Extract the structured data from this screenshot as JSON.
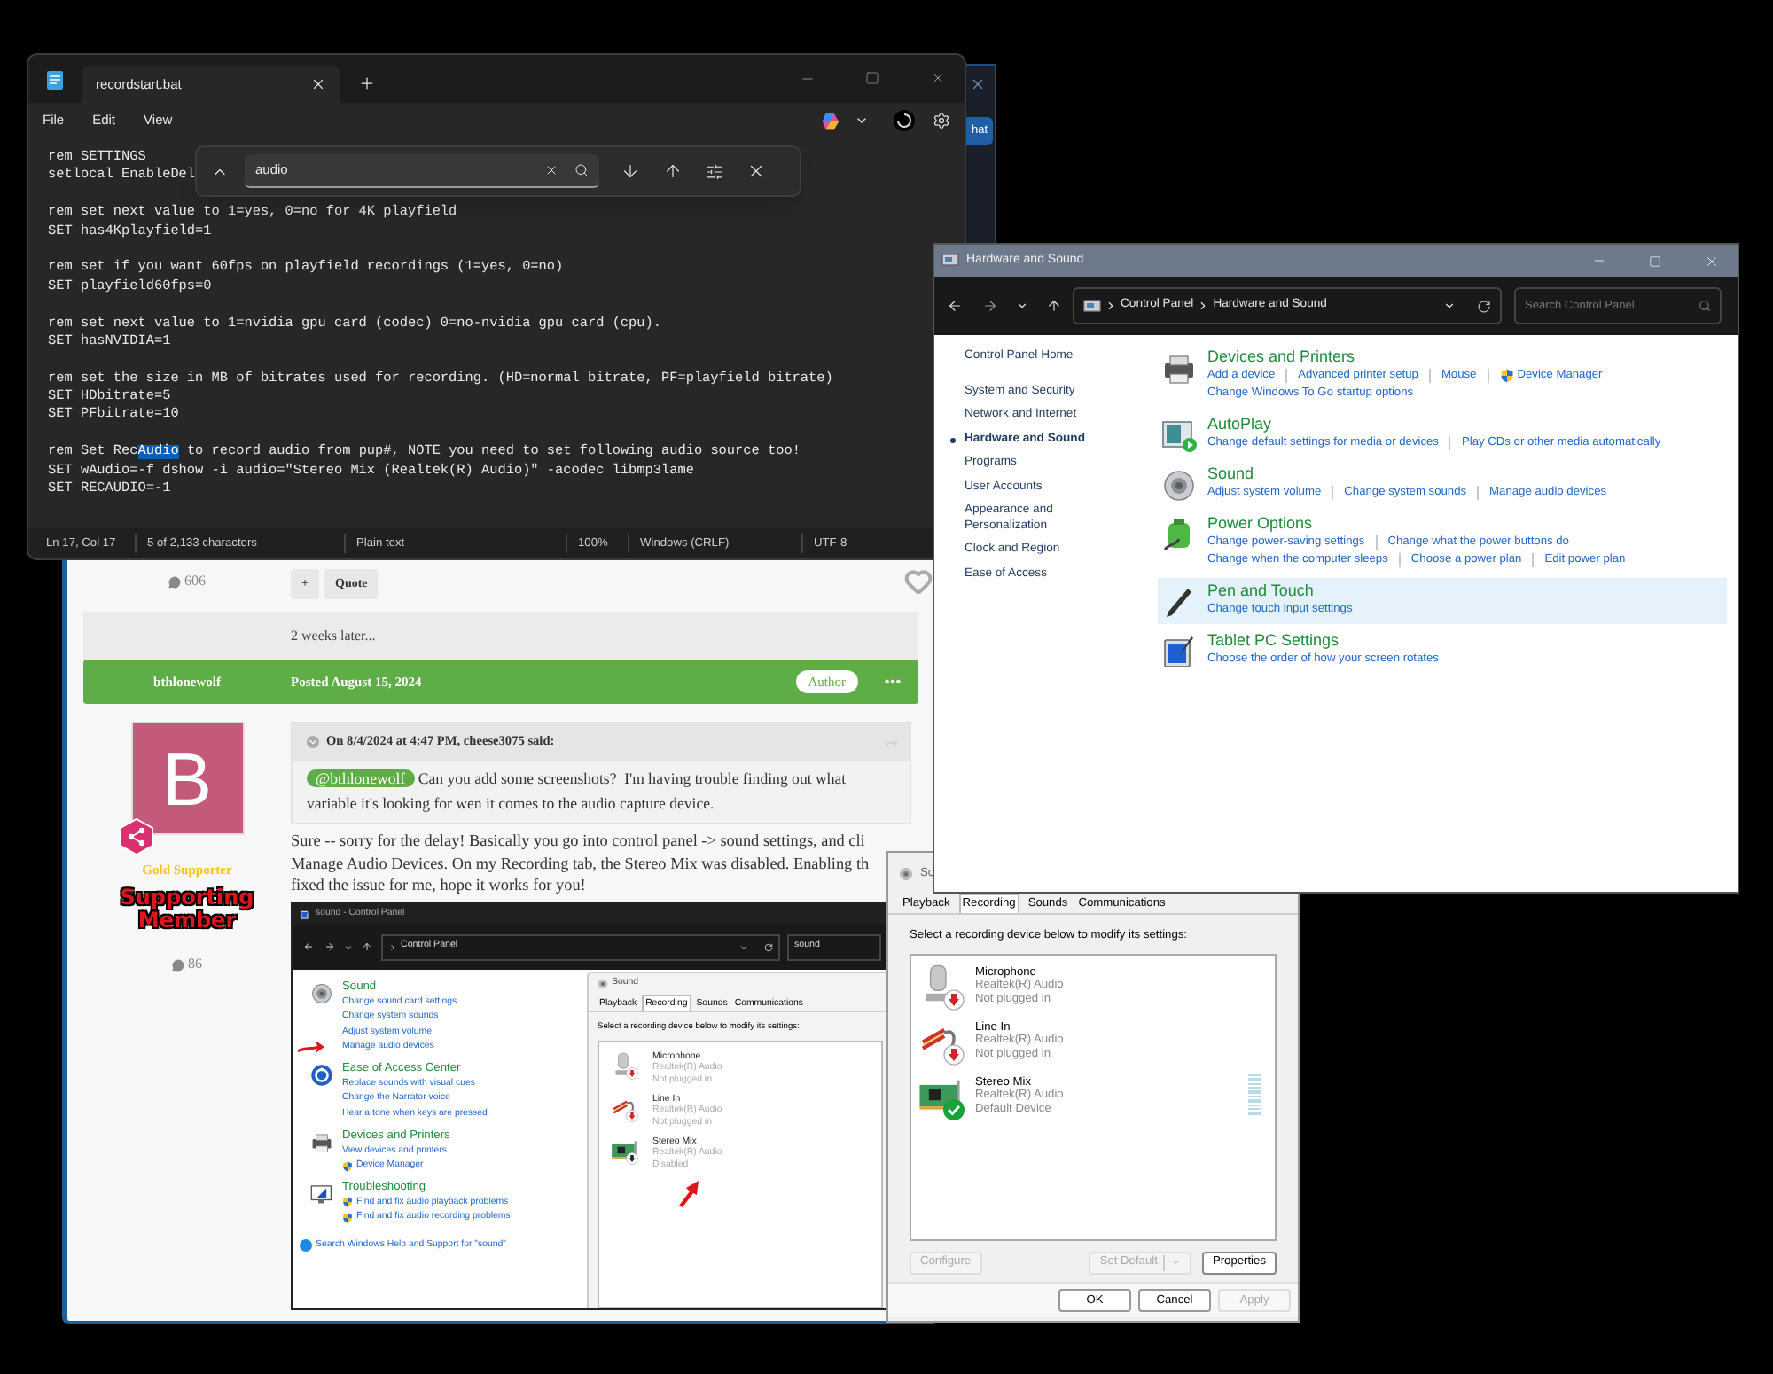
{
  "background_window": {
    "button": "hat"
  },
  "notepad": {
    "tab_title": "recordstart.bat",
    "menu": [
      "File",
      "Edit",
      "View"
    ],
    "find": {
      "value": "audio"
    },
    "blocks": [
      [
        [
          {
            "text": "rem SETTINGS",
            "highlighted": false
          }
        ],
        [
          {
            "text": "setlocal EnableDel",
            "highlighted": false
          }
        ]
      ],
      [
        [
          {
            "text": "rem set next value to 1=yes, 0=no for 4K playfield",
            "highlighted": false
          }
        ],
        [
          {
            "text": "SET has4Kplayfield=1",
            "highlighted": false
          }
        ]
      ],
      [
        [
          {
            "text": "rem set if you want 60fps on playfield recordings (1=yes, 0=no)",
            "highlighted": false
          }
        ],
        [
          {
            "text": "SET playfield60fps=0",
            "highlighted": false
          }
        ]
      ],
      [
        [
          {
            "text": "rem set next value to 1=nvidia gpu card (codec) 0=no-nvidia gpu card (cpu).",
            "highlighted": false
          }
        ],
        [
          {
            "text": "SET hasNVIDIA=1",
            "highlighted": false
          }
        ]
      ],
      [
        [
          {
            "text": "rem set the size in MB of bitrates used for recording. (HD=normal bitrate, PF=playfield bitrate)",
            "highlighted": false
          }
        ],
        [
          {
            "text": "SET HDbitrate=5",
            "highlighted": false
          }
        ],
        [
          {
            "text": "SET PFbitrate=10",
            "highlighted": false
          }
        ]
      ],
      [
        [
          {
            "text": "rem Set Rec",
            "highlighted": false
          },
          {
            "text": "Audio",
            "highlighted": true
          },
          {
            "text": " to record audio from pup#, NOTE you need to set following audio source too!",
            "highlighted": false
          }
        ],
        [
          {
            "text": "SET wAudio=-f dshow -i audio=\"Stereo Mix (Realtek(R) Audio)\" -acodec libmp3lame",
            "highlighted": false
          }
        ],
        [
          {
            "text": "SET RECAUDIO=-1",
            "highlighted": false
          }
        ]
      ]
    ],
    "status_bar": [
      "Ln 17, Col 17",
      "5 of 2,133 characters",
      "Plain text",
      "100%",
      "Windows (CRLF)",
      "UTF-8"
    ]
  },
  "control_panel": {
    "title": "Hardware and Sound",
    "breadcrumb": [
      "Control Panel",
      "Hardware and Sound"
    ],
    "search": {
      "placeholder": "Search Control Panel"
    },
    "sidebar": [
      {
        "label": "Control Panel Home",
        "selected": false
      },
      {
        "label": "System and Security",
        "selected": false
      },
      {
        "label": "Network and Internet",
        "selected": false
      },
      {
        "label": "Hardware and Sound",
        "selected": true
      },
      {
        "label": "Programs",
        "selected": false
      },
      {
        "label": "User Accounts",
        "selected": false
      },
      {
        "label": "Appearance and Personalization",
        "selected": false
      },
      {
        "label": "Clock and Region",
        "selected": false
      },
      {
        "label": "Ease of Access",
        "selected": false
      }
    ],
    "categories": [
      {
        "title": "Devices and Printers",
        "selected": false,
        "link_rows": [
          [
            {
              "text": "Add a device",
              "kind": "plain"
            },
            {
              "text": "Advanced printer setup",
              "kind": "plain"
            },
            {
              "text": "Mouse",
              "kind": "plain"
            },
            {
              "text": "Device Manager",
              "kind": "shield"
            }
          ],
          [
            {
              "text": "Change Windows To Go startup options",
              "kind": "plain"
            }
          ]
        ]
      },
      {
        "title": "AutoPlay",
        "selected": false,
        "link_rows": [
          [
            {
              "text": "Change default settings for media or devices",
              "kind": "plain"
            },
            {
              "text": "Play CDs or other media automatically",
              "kind": "plain"
            }
          ]
        ]
      },
      {
        "title": "Sound",
        "selected": false,
        "link_rows": [
          [
            {
              "text": "Adjust system volume",
              "kind": "plain"
            },
            {
              "text": "Change system sounds",
              "kind": "plain"
            },
            {
              "text": "Manage audio devices",
              "kind": "plain"
            }
          ]
        ]
      },
      {
        "title": "Power Options",
        "selected": false,
        "link_rows": [
          [
            {
              "text": "Change power-saving settings",
              "kind": "plain"
            },
            {
              "text": "Change what the power buttons do",
              "kind": "plain"
            }
          ],
          [
            {
              "text": "Change when the computer sleeps",
              "kind": "plain"
            },
            {
              "text": "Choose a power plan",
              "kind": "plain"
            },
            {
              "text": "Edit power plan",
              "kind": "plain"
            }
          ]
        ]
      },
      {
        "title": "Pen and Touch",
        "selected": true,
        "link_rows": [
          [
            {
              "text": "Change touch input settings",
              "kind": "plain"
            }
          ]
        ]
      },
      {
        "title": "Tablet PC Settings",
        "selected": false,
        "link_rows": [
          [
            {
              "text": "Choose the order of how your screen rotates",
              "kind": "plain"
            }
          ]
        ]
      }
    ]
  },
  "sound_dialog": {
    "title": "So",
    "tabs": [
      {
        "label": "Playback",
        "selected": false
      },
      {
        "label": "Recording",
        "selected": true
      },
      {
        "label": "Sounds",
        "selected": false
      },
      {
        "label": "Communications",
        "selected": false
      }
    ],
    "instruction": "Select a recording device below to modify its settings:",
    "devices": [
      {
        "name": "Microphone",
        "driver": "Realtek(R) Audio",
        "status": "Not plugged in",
        "unplugged": true,
        "is_default": false
      },
      {
        "name": "Line In",
        "driver": "Realtek(R) Audio",
        "status": "Not plugged in",
        "unplugged": true,
        "is_default": false
      },
      {
        "name": "Stereo Mix",
        "driver": "Realtek(R) Audio",
        "status": "Default Device",
        "unplugged": false,
        "is_default": true
      }
    ],
    "buttons": [
      {
        "label": "Configure",
        "kind": "plain",
        "disabled": true
      },
      {
        "label": "Set Default",
        "kind": "split",
        "disabled": true
      },
      {
        "label": "Properties",
        "kind": "plain",
        "disabled": false
      }
    ],
    "footer_buttons": [
      {
        "label": "OK",
        "disabled": false
      },
      {
        "label": "Cancel",
        "disabled": false
      },
      {
        "label": "Apply",
        "disabled": true
      }
    ]
  },
  "forum": {
    "previous_post": {
      "comment_count": "606",
      "buttons": [
        "+",
        "Quote"
      ]
    },
    "time_gap": "2 weeks later...",
    "post": {
      "author": "bthlonewolf",
      "date": "Posted August 15, 2024",
      "badge": "Author",
      "avatar_letter": "B",
      "member_group": "Gold Supporter",
      "rank_title": "Supporting Member",
      "comment_count": "86",
      "quote": {
        "header": "On 8/4/2024 at 4:47 PM, cheese3075 said:",
        "mention": "@bthlonewolf",
        "text": "Can you add some screenshots?  I'm having trouble finding out what variable it's looking for wen it comes to the audio capture device."
      },
      "body_lines": [
        "Sure -- sorry for the delay! Basically you go into control panel -> sound settings, and cli",
        "Manage Audio Devices. On my Recording tab, the Stereo Mix was disabled. Enabling th",
        "fixed the issue for me, hope it works for you!"
      ],
      "screenshot": {
        "title": "sound - Control Panel",
        "address": "Control Panel",
        "search": "sound",
        "sections": [
          {
            "title": "Sound",
            "links": [
              {
                "text": "Change sound card settings",
                "kind": "plain",
                "pointed": false
              },
              {
                "text": "Change system sounds",
                "kind": "plain",
                "pointed": false
              },
              {
                "text": "Adjust system volume",
                "kind": "plain",
                "pointed": false
              },
              {
                "text": "Manage audio devices",
                "kind": "plain",
                "pointed": true
              }
            ]
          },
          {
            "title": "Ease of Access Center",
            "links": [
              {
                "text": "Replace sounds with visual cues",
                "kind": "plain",
                "pointed": false
              },
              {
                "text": "Change the Narrator voice",
                "kind": "plain",
                "pointed": false
              },
              {
                "text": "Hear a tone when keys are pressed",
                "kind": "plain",
                "pointed": false
              }
            ]
          },
          {
            "title": "Devices and Printers",
            "links": [
              {
                "text": "View devices and printers",
                "kind": "plain",
                "pointed": false
              },
              {
                "text": "Device Manager",
                "kind": "shield",
                "pointed": false
              }
            ]
          },
          {
            "title": "Troubleshooting",
            "links": [
              {
                "text": "Find and fix audio playback problems",
                "kind": "shield",
                "pointed": false
              },
              {
                "text": "Find and fix audio recording problems",
                "kind": "shield",
                "pointed": false
              }
            ]
          }
        ],
        "help_link": "Search Windows Help and Support for \"sound\"",
        "dialog": {
          "title": "Sound",
          "tabs": [
            {
              "label": "Playback",
              "selected": false
            },
            {
              "label": "Recording",
              "selected": true
            },
            {
              "label": "Sounds",
              "selected": false
            },
            {
              "label": "Communications",
              "selected": false
            }
          ],
          "instruction": "Select a recording device below to modify its settings:",
          "devices": [
            {
              "name": "Microphone",
              "driver": "Realtek(R) Audio",
              "status": "Not plugged in",
              "unplugged": true,
              "disabled": false,
              "pointed": false
            },
            {
              "name": "Line In",
              "driver": "Realtek(R) Audio",
              "status": "Not plugged in",
              "unplugged": true,
              "disabled": false,
              "pointed": false
            },
            {
              "name": "Stereo Mix",
              "driver": "Realtek(R) Audio",
              "status": "Disabled",
              "unplugged": false,
              "disabled": true,
              "pointed": true
            }
          ]
        }
      }
    }
  }
}
